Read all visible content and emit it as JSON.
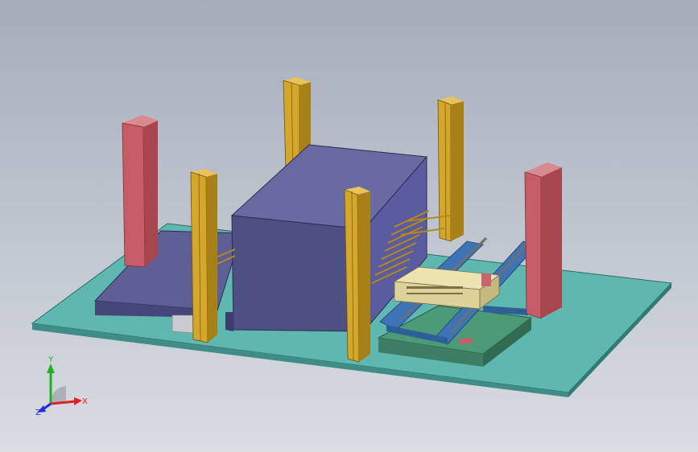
{
  "view": {
    "background_top": "#a5adbb",
    "background_bottom": "#dadde2"
  },
  "colors": {
    "base_plate": "#5fb8b0",
    "machine_body": "#4e4f82",
    "red_pillar": "#c65d66",
    "yellow_column": "#d4a72a",
    "green_platform": "#4c9a78",
    "blue_frame": "#3e74b6",
    "rail_gray": "#6a6f78",
    "console_beige": "#dcd29a"
  },
  "triad": {
    "x_label": "X",
    "y_label": "Y",
    "z_label": "Z",
    "x_color": "#e02020",
    "y_color": "#20b020",
    "z_color": "#2030e0"
  }
}
